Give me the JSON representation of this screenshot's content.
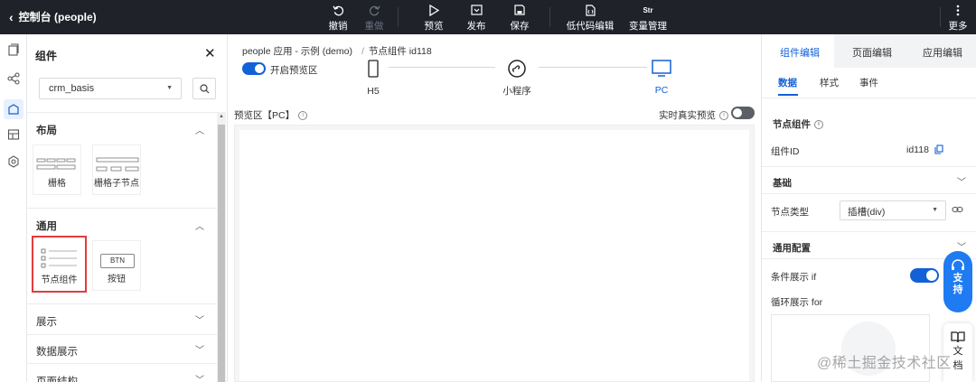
{
  "topbar": {
    "back_label": "控制台 (people)",
    "buttons": {
      "undo": "撤销",
      "redo": "重做",
      "preview": "预览",
      "publish": "发布",
      "save": "保存",
      "lowcode": "低代码编辑",
      "variables": "变量管理",
      "more": "更多"
    },
    "var_icon_text": "Str"
  },
  "panel": {
    "title": "组件",
    "select_value": "crm_basis",
    "sections": {
      "layout": "布局",
      "common": "通用",
      "display": "展示",
      "data_display": "数据展示",
      "page_structure": "页面结构"
    },
    "components": {
      "grid": "栅格",
      "grid_child": "栅格子节点",
      "node": "节点组件",
      "button": "按钮",
      "button_icon_text": "BTN"
    }
  },
  "center": {
    "breadcrumb": {
      "app": "people 应用 - 示例 (demo)",
      "separator": "/",
      "node": "节点组件 id118"
    },
    "preview_toggle_label": "开启预览区",
    "devices": {
      "h5": "H5",
      "mini": "小程序",
      "pc": "PC"
    },
    "stage_label": "预览区【PC】",
    "realtime_label": "实时真实预览"
  },
  "right": {
    "tabs": {
      "component": "组件编辑",
      "page": "页面编辑",
      "app": "应用编辑"
    },
    "subtabs": {
      "data": "数据",
      "style": "样式",
      "event": "事件"
    },
    "node_component_label": "节点组件",
    "component_id_label": "组件ID",
    "component_id_value": "id118",
    "basic_section": "基础",
    "node_type_label": "节点类型",
    "node_type_value": "插槽(div)",
    "general_config": "通用配置",
    "condition_label": "条件展示 if",
    "loop_label": "循环展示 for"
  },
  "floating": {
    "support": "支持",
    "support_2": "持",
    "support_1": "支",
    "doc_1": "文",
    "doc_2": "档"
  },
  "watermark": "@稀土掘金技术社区",
  "colors": {
    "topbar": "#1f2229",
    "accent": "#1261d6",
    "selected_border": "#e03c3c"
  }
}
